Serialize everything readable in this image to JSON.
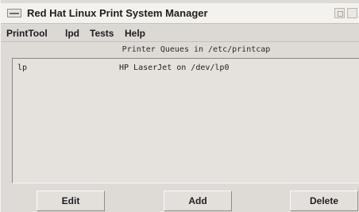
{
  "window": {
    "title": "Red Hat Linux Print System Manager"
  },
  "menubar": {
    "items": [
      "PrintTool",
      "lpd",
      "Tests",
      "Help"
    ]
  },
  "queues": {
    "header": "Printer Queues in /etc/printcap",
    "rows": [
      {
        "name": "lp",
        "description": "HP LaserJet on /dev/lp0"
      }
    ]
  },
  "buttons": {
    "edit": "Edit",
    "add": "Add",
    "delete": "Delete"
  },
  "icons": {
    "window_menu": "window-menu-icon",
    "minimize": "minimize-icon",
    "maximize": "maximize-icon"
  }
}
